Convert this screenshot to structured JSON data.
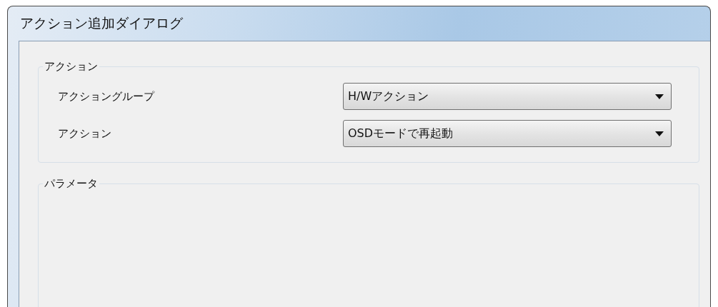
{
  "window": {
    "title": "アクション追加ダイアログ"
  },
  "action_group": {
    "label": "アクション",
    "fields": [
      {
        "label": "アクショングループ",
        "value": "H/Wアクション"
      },
      {
        "label": "アクション",
        "value": "OSDモードで再起動"
      }
    ]
  },
  "parameter_group": {
    "label": "パラメータ"
  }
}
